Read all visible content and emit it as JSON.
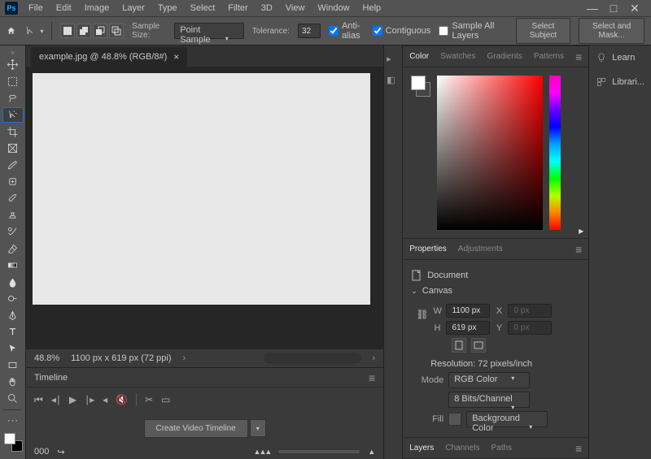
{
  "menu": [
    "File",
    "Edit",
    "Image",
    "Layer",
    "Type",
    "Select",
    "Filter",
    "3D",
    "View",
    "Window",
    "Help"
  ],
  "optbar": {
    "sample_size_label": "Sample Size:",
    "sample_size_value": "Point Sample",
    "tolerance_label": "Tolerance:",
    "tolerance_value": "32",
    "anti_alias": "Anti-alias",
    "contiguous": "Contiguous",
    "sample_all": "Sample All Layers",
    "select_subject": "Select Subject",
    "select_mask": "Select and Mask..."
  },
  "doc": {
    "tab": "example.jpg @ 48.8% (RGB/8#)"
  },
  "status": {
    "zoom": "48.8%",
    "dims": "1100 px x 619 px (72 ppi)"
  },
  "timeline": {
    "title": "Timeline",
    "create_btn": "Create Video Timeline",
    "footer": "000"
  },
  "color_tabs": [
    "Color",
    "Swatches",
    "Gradients",
    "Patterns"
  ],
  "prop_tabs": [
    "Properties",
    "Adjustments"
  ],
  "layer_tabs": [
    "Layers",
    "Channels",
    "Paths"
  ],
  "right": {
    "learn": "Learn",
    "libraries": "Librari..."
  },
  "properties": {
    "doc_label": "Document",
    "section": "Canvas",
    "w_label": "W",
    "w_val": "1100 px",
    "h_label": "H",
    "h_val": "619 px",
    "x_label": "X",
    "x_val": "0 px",
    "y_label": "Y",
    "y_val": "0 px",
    "res": "Resolution: 72 pixels/inch",
    "mode_label": "Mode",
    "mode_val": "RGB Color",
    "depth_val": "8 Bits/Channel",
    "fill_label": "Fill",
    "fill_val": "Background Color"
  }
}
